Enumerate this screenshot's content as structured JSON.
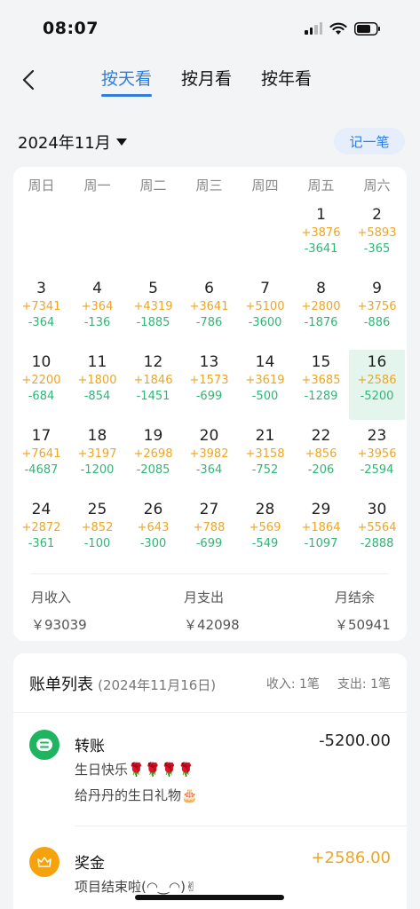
{
  "status": {
    "time": "08:07"
  },
  "nav": {
    "tabs": [
      {
        "label": "按天看"
      },
      {
        "label": "按月看"
      },
      {
        "label": "按年看"
      }
    ]
  },
  "month_picker": {
    "label": "2024年11月",
    "record_label": "记一笔"
  },
  "calendar": {
    "weekdays": [
      "周日",
      "周一",
      "周二",
      "周三",
      "周四",
      "周五",
      "周六"
    ],
    "selected_day": "16",
    "days": [
      {
        "day": "1",
        "income": "+3876",
        "expense": "-3641"
      },
      {
        "day": "2",
        "income": "+5893",
        "expense": "-365"
      },
      {
        "day": "3",
        "income": "+7341",
        "expense": "-364"
      },
      {
        "day": "4",
        "income": "+364",
        "expense": "-136"
      },
      {
        "day": "5",
        "income": "+4319",
        "expense": "-1885"
      },
      {
        "day": "6",
        "income": "+3641",
        "expense": "-786"
      },
      {
        "day": "7",
        "income": "+5100",
        "expense": "-3600"
      },
      {
        "day": "8",
        "income": "+2800",
        "expense": "-1876"
      },
      {
        "day": "9",
        "income": "+3756",
        "expense": "-886"
      },
      {
        "day": "10",
        "income": "+2200",
        "expense": "-684"
      },
      {
        "day": "11",
        "income": "+1800",
        "expense": "-854"
      },
      {
        "day": "12",
        "income": "+1846",
        "expense": "-1451"
      },
      {
        "day": "13",
        "income": "+1573",
        "expense": "-699"
      },
      {
        "day": "14",
        "income": "+3619",
        "expense": "-500"
      },
      {
        "day": "15",
        "income": "+3685",
        "expense": "-1289"
      },
      {
        "day": "16",
        "income": "+2586",
        "expense": "-5200"
      },
      {
        "day": "17",
        "income": "+7641",
        "expense": "-4687"
      },
      {
        "day": "18",
        "income": "+3197",
        "expense": "-1200"
      },
      {
        "day": "19",
        "income": "+2698",
        "expense": "-2085"
      },
      {
        "day": "20",
        "income": "+3982",
        "expense": "-364"
      },
      {
        "day": "21",
        "income": "+3158",
        "expense": "-752"
      },
      {
        "day": "22",
        "income": "+856",
        "expense": "-206"
      },
      {
        "day": "23",
        "income": "+3956",
        "expense": "-2594"
      },
      {
        "day": "24",
        "income": "+2872",
        "expense": "-361"
      },
      {
        "day": "25",
        "income": "+852",
        "expense": "-100"
      },
      {
        "day": "26",
        "income": "+643",
        "expense": "-300"
      },
      {
        "day": "27",
        "income": "+788",
        "expense": "-699"
      },
      {
        "day": "28",
        "income": "+569",
        "expense": "-549"
      },
      {
        "day": "29",
        "income": "+1864",
        "expense": "-1097"
      },
      {
        "day": "30",
        "income": "+5564",
        "expense": "-2888"
      }
    ]
  },
  "summary": {
    "income": {
      "label": "月收入",
      "value": "￥93039"
    },
    "expense": {
      "label": "月支出",
      "value": "￥42098"
    },
    "balance": {
      "label": "月结余",
      "value": "￥50941"
    }
  },
  "bill_list": {
    "title": "账单列表",
    "date": "(2024年11月16日)",
    "income_count": "收入: 1笔",
    "expense_count": "支出: 1笔",
    "items": [
      {
        "title": "转账",
        "amount": "-5200.00",
        "line1": "生日快乐🌹🌹🌹🌹",
        "line2": "给丹丹的生日礼物🎂",
        "icon": "transfer-icon"
      },
      {
        "title": "奖金",
        "amount": "+2586.00",
        "line1": "项目结束啦(◠‿◠)✌",
        "icon": "crown-icon"
      }
    ]
  },
  "colors": {
    "accent": "#2f7de1",
    "income": "#eda624",
    "expense": "#2fb676",
    "selected_bg": "#e3f5ec",
    "transfer_icon_bg": "#1fb560",
    "bonus_icon_bg": "#f5a20d"
  }
}
